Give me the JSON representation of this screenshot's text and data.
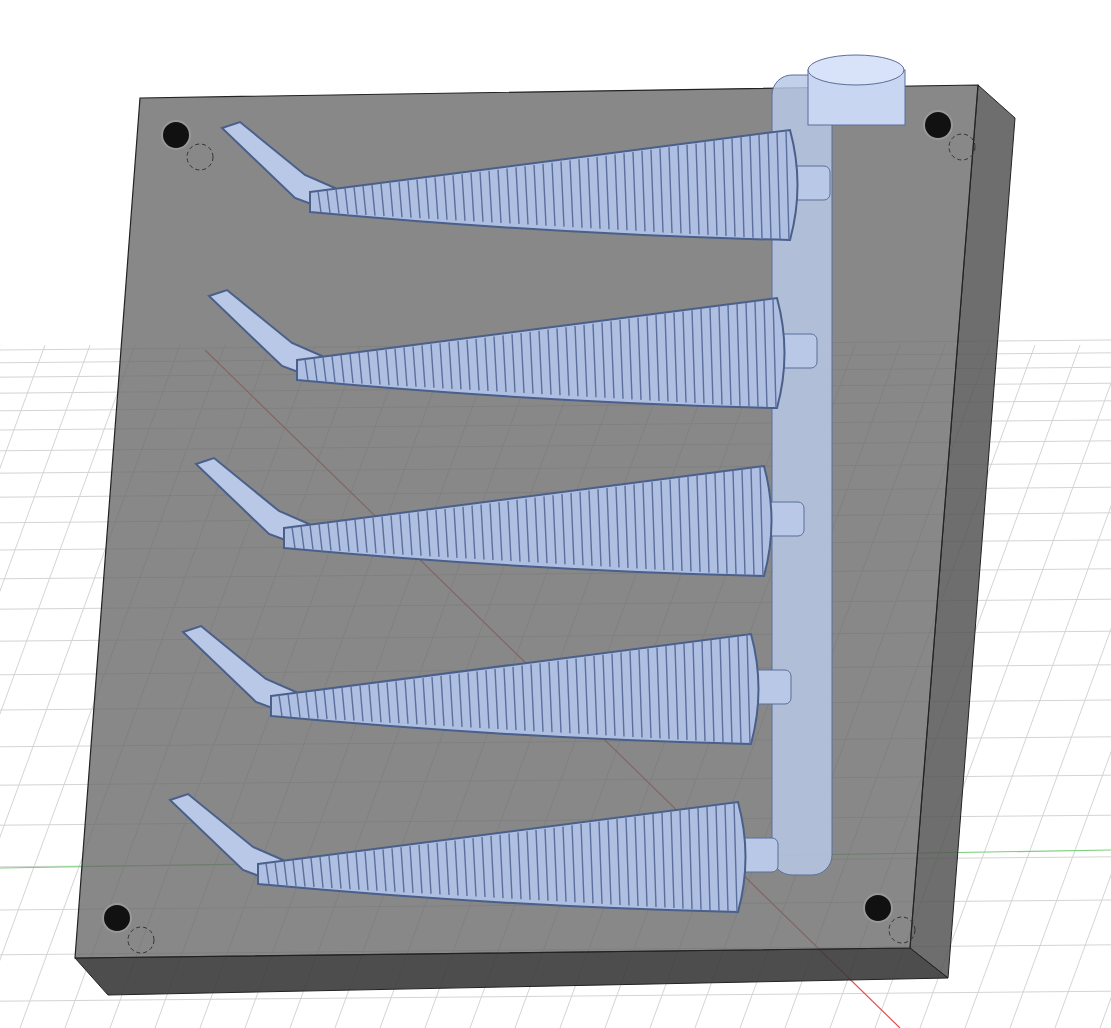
{
  "viewport": {
    "grid": true,
    "axes": true
  },
  "mold": {
    "sprue": true,
    "cavities": [
      {
        "kind": "ribbed-worm"
      },
      {
        "kind": "ribbed-worm"
      },
      {
        "kind": "ribbed-worm"
      },
      {
        "kind": "ribbed-worm"
      },
      {
        "kind": "ribbed-worm"
      }
    ],
    "pin_holes": [
      {
        "kind": "hole"
      },
      {
        "kind": "hole"
      },
      {
        "kind": "hole"
      },
      {
        "kind": "hole"
      }
    ]
  }
}
